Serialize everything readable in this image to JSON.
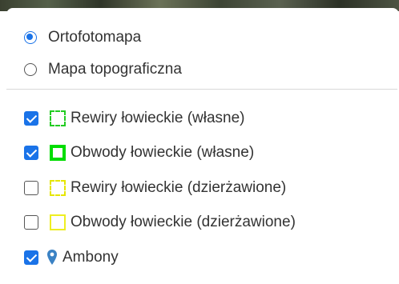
{
  "base_layers": [
    {
      "label": "Ortofotomapa",
      "checked": true
    },
    {
      "label": "Mapa topograficzna",
      "checked": false
    }
  ],
  "overlays": [
    {
      "label": "Rewiry łowieckie (własne)",
      "checked": true,
      "swatch": "green-dashed",
      "color": "#22cc22"
    },
    {
      "label": "Obwody łowieckie (własne)",
      "checked": true,
      "swatch": "green-solid",
      "color": "#00dd00"
    },
    {
      "label": "Rewiry łowieckie (dzierżawione)",
      "checked": false,
      "swatch": "yellow-dashed",
      "color": "#e6e600"
    },
    {
      "label": "Obwody łowieckie (dzierżawione)",
      "checked": false,
      "swatch": "yellow-solid",
      "color": "#eeee22"
    },
    {
      "label": "Ambony",
      "checked": true,
      "icon": "map-pin-icon",
      "color": "#3b82c4"
    }
  ],
  "colors": {
    "accent": "#1a73e8"
  }
}
